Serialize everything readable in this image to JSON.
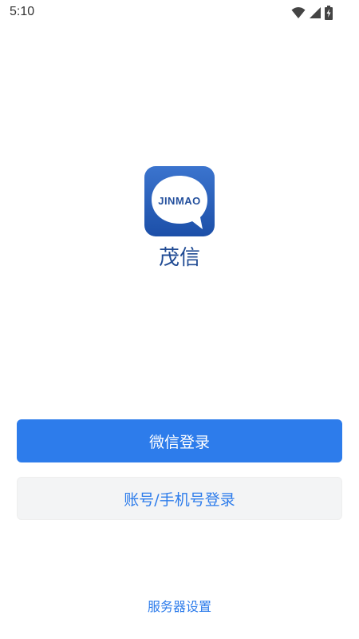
{
  "status_bar": {
    "time": "5:10",
    "icons": [
      "wifi-icon",
      "cellular-signal-icon",
      "battery-charging-icon"
    ]
  },
  "logo": {
    "text": "JINMAO",
    "icon": "chat-bubble-logo-icon"
  },
  "app": {
    "name": "茂信"
  },
  "buttons": {
    "wechat_login": "微信登录",
    "account_login": "账号/手机号登录"
  },
  "footer": {
    "server_settings": "服务器设置"
  },
  "colors": {
    "primary": "#2d7ceb",
    "logo_blue": "#2b63bd",
    "secondary_bg": "#f3f4f5",
    "app_name": "#1f4a93"
  }
}
